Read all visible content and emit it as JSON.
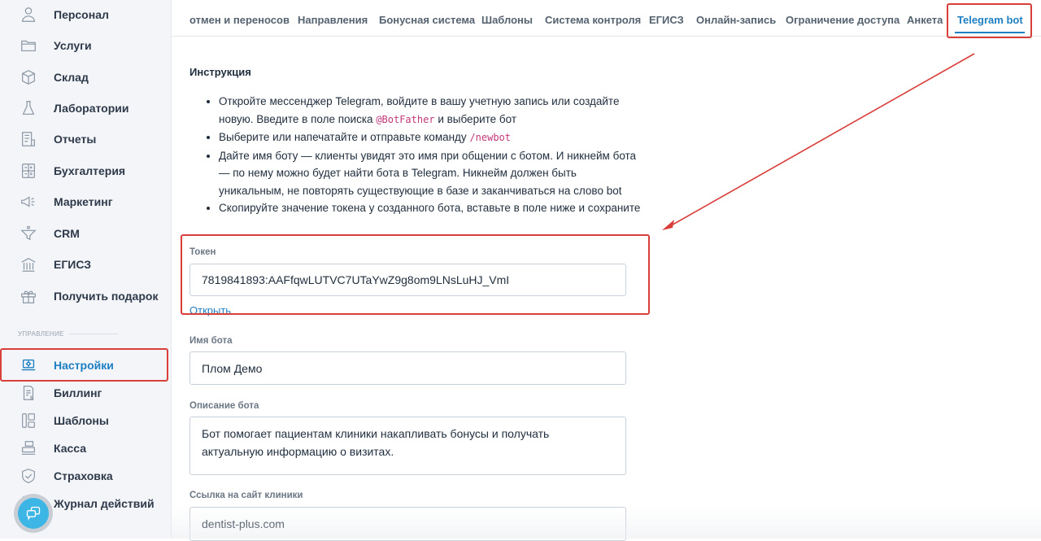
{
  "sidebar": {
    "items": [
      {
        "label": "Персонал",
        "icon": "person-icon"
      },
      {
        "label": "Услуги",
        "icon": "folder-icon"
      },
      {
        "label": "Склад",
        "icon": "box-icon"
      },
      {
        "label": "Лаборатории",
        "icon": "flask-icon"
      },
      {
        "label": "Отчеты",
        "icon": "report-icon"
      },
      {
        "label": "Бухгалтерия",
        "icon": "calculator-icon"
      },
      {
        "label": "Маркетинг",
        "icon": "megaphone-icon"
      },
      {
        "label": "CRM",
        "icon": "funnel-icon"
      },
      {
        "label": "ЕГИСЗ",
        "icon": "building-icon"
      },
      {
        "label": "Получить подарок",
        "icon": "gift-icon"
      }
    ],
    "section_label": "УПРАВЛЕНИЕ",
    "manage_items": [
      {
        "label": "Настройки",
        "icon": "settings-laptop-icon",
        "active": true
      },
      {
        "label": "Биллинг",
        "icon": "invoice-icon"
      },
      {
        "label": "Шаблоны",
        "icon": "template-icon"
      },
      {
        "label": "Касса",
        "icon": "cash-register-icon"
      },
      {
        "label": "Страховка",
        "icon": "shield-icon"
      },
      {
        "label": "Журнал действий",
        "icon": "log-icon"
      }
    ]
  },
  "tabs": [
    {
      "label": "отмен и переносов"
    },
    {
      "label": "Направления"
    },
    {
      "label": "Бонусная система"
    },
    {
      "label": "Шаблоны"
    },
    {
      "label": "Система контроля"
    },
    {
      "label": "ЕГИСЗ"
    },
    {
      "label": "Онлайн-запись"
    },
    {
      "label": "Ограничение доступа"
    },
    {
      "label": "Анкета"
    },
    {
      "label": "Telegram bot",
      "active": true
    }
  ],
  "instructions": {
    "title": "Инструкция",
    "step1_a": "Откройте мессенджер Telegram, войдите в вашу учетную запись или создайте новую. Введите в поле поиска ",
    "step1_code": "@BotFather",
    "step1_b": " и выберите бот",
    "step2_a": "Выберите или напечатайте и отправьте команду ",
    "step2_code": "/newbot",
    "step3": "Дайте имя боту — клиенты увидят это имя при общении с ботом. И никнейм бота — по нему можно будет найти бота в Telegram. Никнейм должен быть уникальным, не повторять существующие в базе и заканчиваться на слово bot",
    "step4": "Скопируйте значение токена у созданного бота, вставьте в поле ниже и сохраните"
  },
  "form": {
    "token_label": "Токен",
    "token_value": "7819841893:AAFfqwLUTVC7UTaYwZ9g8om9LNsLuHJ_VmI",
    "open_link": "Открыть",
    "bot_name_label": "Имя бота",
    "bot_name_value": "Плом Демо",
    "bot_desc_label": "Описание бота",
    "bot_desc_value": "Бот помогает пациентам клиники накапливать бонусы и получать актуальную информацию о визитах.",
    "site_label": "Ссылка на сайт клиники",
    "site_value": "dentist-plus.com"
  },
  "colors": {
    "accent": "#1f7fc3",
    "highlight": "#d93f3a",
    "code": "#c2387a"
  }
}
